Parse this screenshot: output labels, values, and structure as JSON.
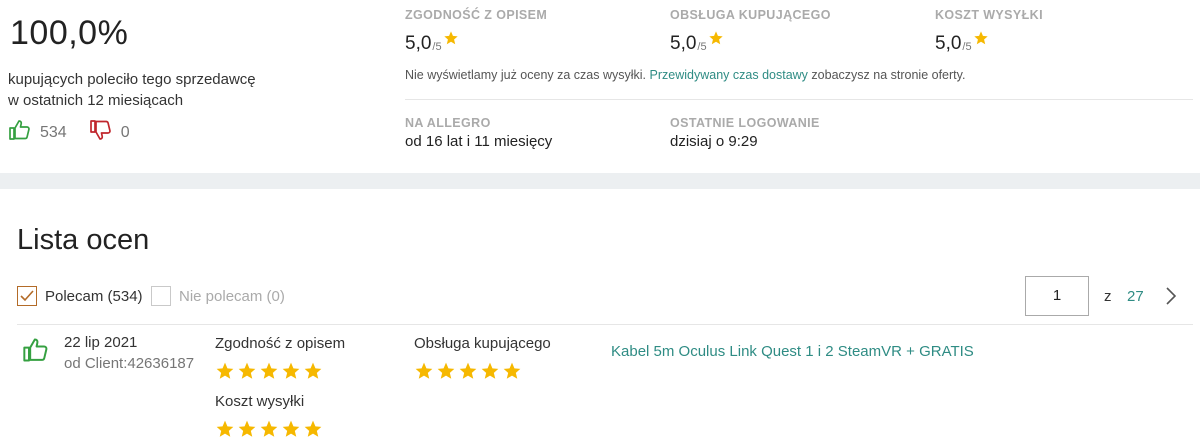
{
  "summary": {
    "percent": "100,0%",
    "line1": "kupujących poleciło tego sprzedawcę",
    "line2": "w ostatnich 12 miesiącach",
    "positive_count": "534",
    "negative_count": "0"
  },
  "metrics": [
    {
      "label": "ZGODNOŚĆ Z OPISEM",
      "score": "5,0",
      "denominator": "/5"
    },
    {
      "label": "OBSŁUGA KUPUJĄCEGO",
      "score": "5,0",
      "denominator": "/5"
    },
    {
      "label": "KOSZT WYSYŁKI",
      "score": "5,0",
      "denominator": "/5"
    }
  ],
  "note": {
    "before": "Nie wyświetlamy już oceny za czas wysyłki.",
    "link": "Przewidywany czas dostawy",
    "after": "zobaczysz na stronie oferty."
  },
  "info": [
    {
      "label": "NA ALLEGRO",
      "value": "od 16 lat i 11 miesięcy"
    },
    {
      "label": "OSTATNIE LOGOWANIE",
      "value": "dzisiaj o 9:29"
    }
  ],
  "list": {
    "title": "Lista ocen",
    "filter_positive": "Polecam (534)",
    "filter_negative": "Nie polecam (0)",
    "page_current": "1",
    "page_of": "z",
    "page_total": "27"
  },
  "review": {
    "date": "22 lip 2021",
    "author": "od Client:42636187",
    "criteria": [
      {
        "label": "Zgodność z opisem",
        "stars": 5
      },
      {
        "label": "Obsługa kupującego",
        "stars": 5
      },
      {
        "label": "Koszt wysyłki",
        "stars": 5
      }
    ],
    "product": "Kabel 5m Oculus Link Quest 1 i 2 SteamVR + GRATIS"
  },
  "colors": {
    "star": "#f6b800",
    "positive": "#35a041",
    "negative": "#c0262c",
    "link": "#2f8c84",
    "checkbox": "#b36b28"
  }
}
